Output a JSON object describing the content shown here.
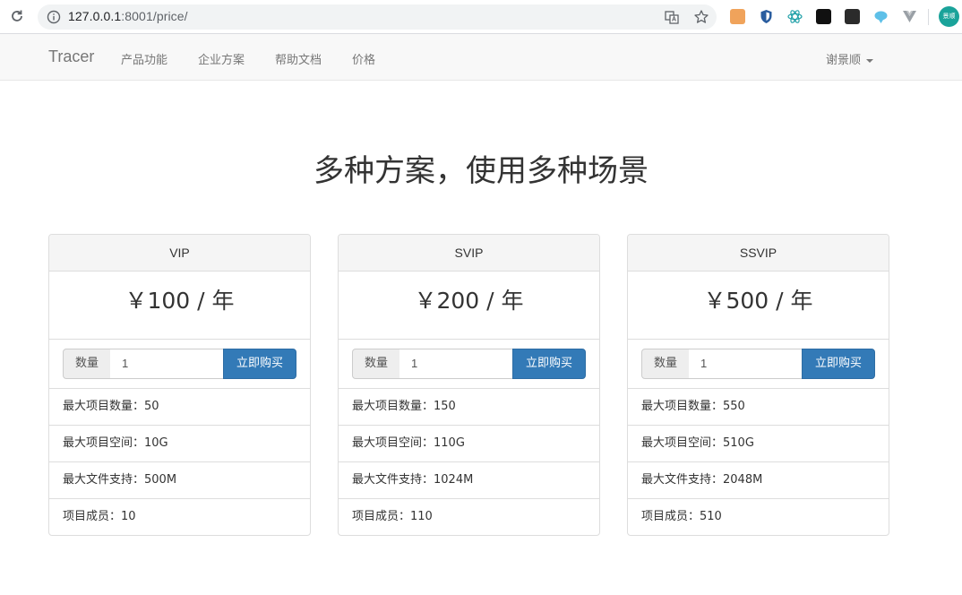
{
  "browser": {
    "url_host": "127.0.0.1",
    "url_port_path": ":8001/price/",
    "profile_label": "景顺"
  },
  "navbar": {
    "brand": "Tracer",
    "links": [
      "产品功能",
      "企业方案",
      "帮助文档",
      "价格"
    ],
    "user": "谢景顺"
  },
  "page": {
    "title": "多种方案，使用多种场景"
  },
  "plans": [
    {
      "name": "VIP",
      "price": "￥100 / 年",
      "qty_label": "数量",
      "qty_value": "1",
      "buy_label": "立即购买",
      "features": [
        "最大项目数量：50",
        "最大项目空间：10G",
        "最大文件支持：500M",
        "项目成员：10"
      ]
    },
    {
      "name": "SVIP",
      "price": "￥200 / 年",
      "qty_label": "数量",
      "qty_value": "1",
      "buy_label": "立即购买",
      "features": [
        "最大项目数量：150",
        "最大项目空间：110G",
        "最大文件支持：1024M",
        "项目成员：110"
      ]
    },
    {
      "name": "SSVIP",
      "price": "￥500 / 年",
      "qty_label": "数量",
      "qty_value": "1",
      "buy_label": "立即购买",
      "features": [
        "最大项目数量：550",
        "最大项目空间：510G",
        "最大文件支持：2048M",
        "项目成员：510"
      ]
    }
  ],
  "colors": {
    "primary": "#337ab7",
    "navbar_bg": "#f8f8f8",
    "panel_head_bg": "#f5f5f5"
  }
}
